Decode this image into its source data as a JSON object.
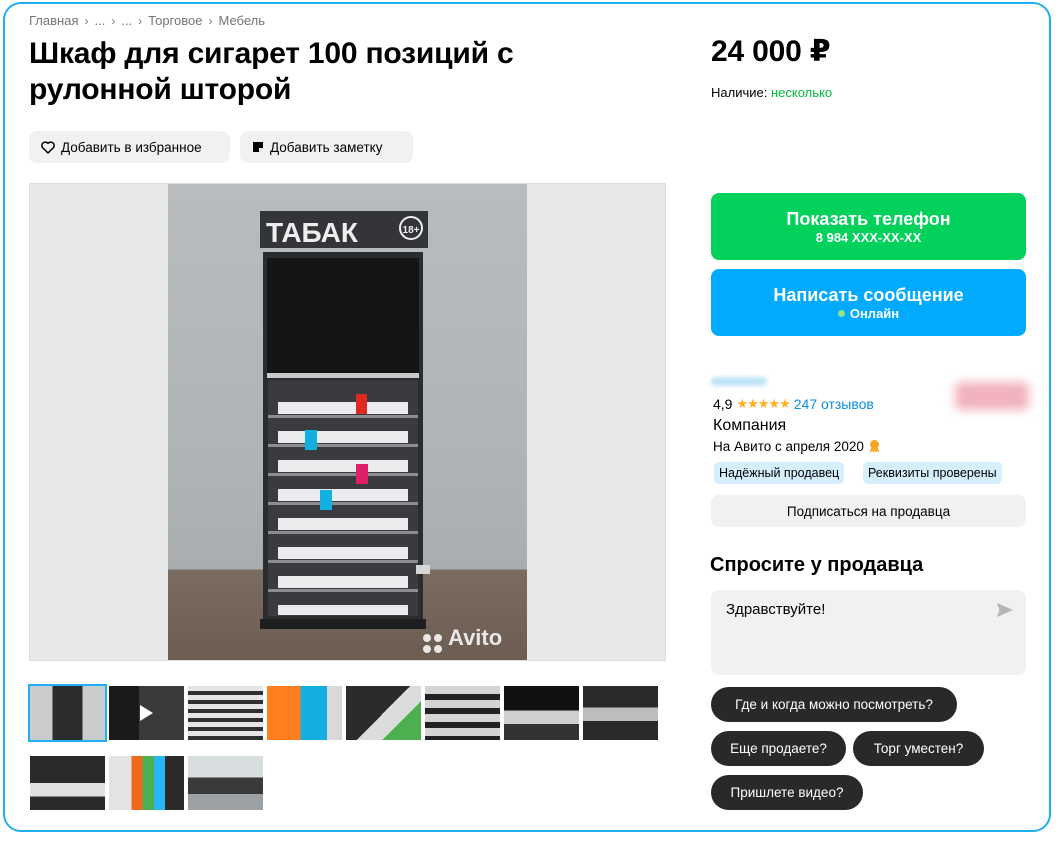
{
  "breadcrumb": [
    "Главная",
    "...",
    "...",
    "Торговое",
    "Мебель"
  ],
  "title": "Шкаф для сигарет 100 позиций с рулонной шторой",
  "actions": {
    "favorite_label": "Добавить в избранное",
    "note_label": "Добавить заметку"
  },
  "photo": {
    "sign_text": "ТАБАК",
    "age_badge": "18+",
    "watermark": "Avito"
  },
  "gallery": {
    "thumbnail_count": 11,
    "active_index": 0
  },
  "price": "24 000 ₽",
  "availability": {
    "label": "Наличие:",
    "value": "несколько"
  },
  "contact": {
    "phone_label": "Показать телефон",
    "phone_masked": "8 984 XXX-XX-XX",
    "message_label": "Написать сообщение",
    "online_label": "Онлайн"
  },
  "seller": {
    "rating": "4,9",
    "stars": "★★★★★",
    "reviews": "247 отзывов",
    "type": "Компания",
    "since": "На Авито с апреля 2020",
    "badges": [
      "Надёжный продавец",
      "Реквизиты проверены"
    ],
    "subscribe_label": "Подписаться на продавца"
  },
  "ask": {
    "title": "Спросите у продавца",
    "message": "Здравствуйте!",
    "quick_questions": [
      "Где и когда можно посмотреть?",
      "Еще продаете?",
      "Торг уместен?",
      "Пришлете видео?"
    ]
  },
  "colors": {
    "accent_green": "#02d15c",
    "accent_blue": "#00aaff",
    "availability_green": "#02b83d",
    "frame_blue": "#1eb0f0",
    "star_yellow": "#ffb021",
    "link_blue": "#0a8ee6",
    "chip_dark": "#292929"
  }
}
